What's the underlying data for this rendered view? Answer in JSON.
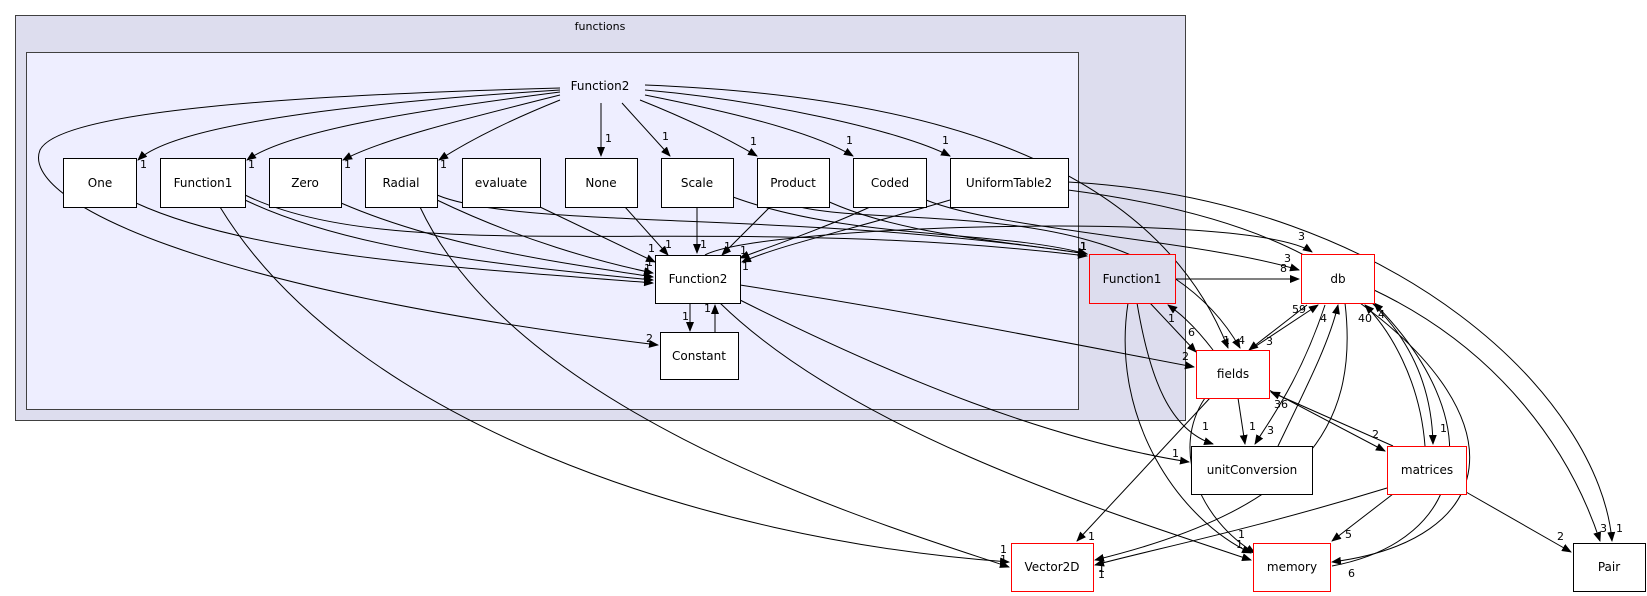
{
  "colors": {
    "outer_cluster_fill": "#ddddee",
    "inner_cluster_fill": "#eeeeff",
    "cluster_border": "#404040",
    "highlight_border": "#ff0000"
  },
  "clusters": {
    "outer": "functions",
    "inner_label": "Function2"
  },
  "nodes": {
    "one": "One",
    "function1_inner": "Function1",
    "zero": "Zero",
    "radial": "Radial",
    "evaluate": "evaluate",
    "none": "None",
    "scale": "Scale",
    "product": "Product",
    "coded": "Coded",
    "uniformtable2": "UniformTable2",
    "function2": "Function2",
    "constant": "Constant",
    "function1": "Function1",
    "db": "db",
    "fields": "fields",
    "unitconversion": "unitConversion",
    "matrices": "matrices",
    "vector2d": "Vector2D",
    "memory": "memory",
    "pair": "Pair"
  },
  "edges": [
    {
      "from": "Function2",
      "to": "One",
      "label": "1"
    },
    {
      "from": "Function2",
      "to": "Function1",
      "label": "1"
    },
    {
      "from": "Function2",
      "to": "Zero",
      "label": "1"
    },
    {
      "from": "Function2",
      "to": "Radial",
      "label": "1"
    },
    {
      "from": "Function2",
      "to": "None",
      "label": "1"
    },
    {
      "from": "Function2",
      "to": "Scale",
      "label": "1"
    },
    {
      "from": "Function2",
      "to": "Product",
      "label": "1"
    },
    {
      "from": "Function2",
      "to": "Coded",
      "label": "1"
    },
    {
      "from": "Function2",
      "to": "UniformTable2",
      "label": "1"
    },
    {
      "from": "Function2",
      "to": "Constant",
      "label": "2"
    },
    {
      "from": "Function2",
      "to": "fields",
      "label": "1"
    },
    {
      "from": "One",
      "to": "Function2",
      "label": "1"
    },
    {
      "from": "Function1",
      "to": "Function2",
      "label": "1"
    },
    {
      "from": "Zero",
      "to": "Function2",
      "label": "1"
    },
    {
      "from": "Radial",
      "to": "Function2",
      "label": "1"
    },
    {
      "from": "evaluate",
      "to": "Function2",
      "label": "1"
    },
    {
      "from": "None",
      "to": "Function2",
      "label": "1"
    },
    {
      "from": "Scale",
      "to": "Function2",
      "label": "1"
    },
    {
      "from": "Product",
      "to": "Function2",
      "label": "1"
    },
    {
      "from": "Coded",
      "to": "Function2",
      "label": "1"
    },
    {
      "from": "UniformTable2",
      "to": "Function2",
      "label": "1"
    },
    {
      "from": "Function1",
      "to": "Function1 (red)",
      "label": "1"
    },
    {
      "from": "Radial",
      "to": "Function1 (red)",
      "label": "1"
    },
    {
      "from": "Scale",
      "to": "Function1 (red)",
      "label": "1"
    },
    {
      "from": "Product",
      "to": "Function1 (red)",
      "label": "1"
    },
    {
      "from": "Function1",
      "to": "Vector2D",
      "label": "1"
    },
    {
      "from": "Radial",
      "to": "Vector2D",
      "label": "1"
    },
    {
      "from": "Function2",
      "to": "Constant",
      "label": "1"
    },
    {
      "from": "Constant",
      "to": "Function2",
      "label": "1"
    },
    {
      "from": "Function2",
      "to": "fields",
      "label": "2"
    },
    {
      "from": "Function2",
      "to": "unitConversion",
      "label": "1"
    },
    {
      "from": "Function2",
      "to": "memory",
      "label": ""
    },
    {
      "from": "Product",
      "to": "fields",
      "label": "4"
    },
    {
      "from": "Coded",
      "to": "db",
      "label": "3"
    },
    {
      "from": "Function2",
      "to": "db",
      "label": "3"
    },
    {
      "from": "UniformTable2",
      "to": "matrices",
      "label": "1"
    },
    {
      "from": "UniformTable2",
      "to": "Pair",
      "label": "1"
    },
    {
      "from": "Function1",
      "to": "db",
      "label": "8"
    },
    {
      "from": "Function1",
      "to": "fields",
      "label": "6"
    },
    {
      "from": "fields",
      "to": "Function1",
      "label": "1"
    },
    {
      "from": "Function1",
      "to": "unitConversion",
      "label": "1"
    },
    {
      "from": "Function1",
      "to": "memory",
      "label": "1"
    },
    {
      "from": "fields",
      "to": "db",
      "label": "59"
    },
    {
      "from": "db",
      "to": "fields",
      "label": "3"
    },
    {
      "from": "fields",
      "to": "unitConversion",
      "label": "1"
    },
    {
      "from": "fields",
      "to": "Vector2D",
      "label": "1"
    },
    {
      "from": "fields",
      "to": "memory",
      "label": "1"
    },
    {
      "from": "fields",
      "to": "matrices",
      "label": "2"
    },
    {
      "from": "matrices",
      "to": "fields",
      "label": "36"
    },
    {
      "from": "unitConversion",
      "to": "db",
      "label": "4"
    },
    {
      "from": "db",
      "to": "unitConversion",
      "label": "3"
    },
    {
      "from": "db",
      "to": "Vector2D",
      "label": "1"
    },
    {
      "from": "db",
      "to": "memory",
      "label": "6"
    },
    {
      "from": "memory",
      "to": "db",
      "label": "4"
    },
    {
      "from": "db",
      "to": "Pair",
      "label": "3"
    },
    {
      "from": "matrices",
      "to": "db",
      "label": "40"
    },
    {
      "from": "matrices",
      "to": "Vector2D",
      "label": "1"
    },
    {
      "from": "matrices",
      "to": "memory",
      "label": "5"
    },
    {
      "from": "matrices",
      "to": "Pair",
      "label": "2"
    }
  ]
}
